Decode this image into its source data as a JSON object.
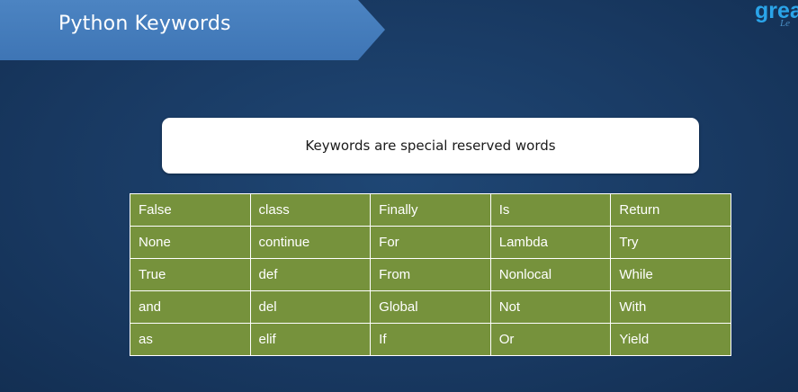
{
  "title": "Python Keywords",
  "logo": {
    "main": "grea",
    "sub": "Le"
  },
  "callout": "Keywords are special reserved words",
  "keywords_table": {
    "rows": [
      [
        "False",
        "class",
        "Finally",
        "Is",
        "Return"
      ],
      [
        "None",
        "continue",
        "For",
        "Lambda",
        "Try"
      ],
      [
        "True",
        "def",
        "From",
        "Nonlocal",
        "While"
      ],
      [
        "and",
        "del",
        "Global",
        "Not",
        "With"
      ],
      [
        "as",
        "elif",
        "If",
        "Or",
        "Yield"
      ]
    ]
  },
  "colors": {
    "background": "#193a63",
    "banner": "#4679ba",
    "table_cell": "#76923c",
    "logo": "#2aa4e9"
  }
}
